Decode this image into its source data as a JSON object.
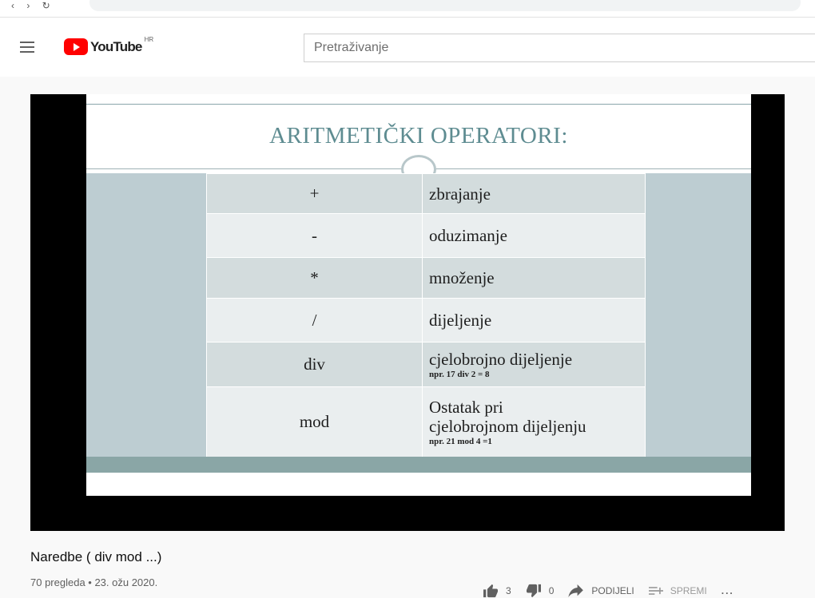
{
  "header": {
    "logo_text": "YouTube",
    "country_code": "HR",
    "search_placeholder": "Pretraživanje"
  },
  "slide": {
    "title": "ARITMETIČKI OPERATORI:",
    "rows": [
      {
        "op": "+",
        "desc": "zbrajanje",
        "extra": "",
        "example": ""
      },
      {
        "op": "-",
        "desc": "oduzimanje",
        "extra": "",
        "example": ""
      },
      {
        "op": "*",
        "desc": "množenje",
        "extra": "",
        "example": ""
      },
      {
        "op": "/",
        "desc": "dijeljenje",
        "extra": "",
        "example": ""
      },
      {
        "op": "div",
        "desc": "cjelobrojno dijeljenje",
        "extra": "",
        "example": "npr. 17 div 2 = 8"
      },
      {
        "op": "mod",
        "desc": "Ostatak pri",
        "extra": "cjelobrojnom dijeljenju",
        "example": "npr. 21 mod 4 =1"
      }
    ]
  },
  "video": {
    "title": "Naredbe ( div mod ...)",
    "meta": "70 pregleda • 23. ožu 2020."
  },
  "actions": {
    "likes": "3",
    "dislikes": "0",
    "share_label": "PODIJELI",
    "save_label": "SPREMI",
    "more_label": "..."
  },
  "colors": {
    "brand_red": "#ff0000",
    "slide_accent": "#5e8c91"
  }
}
